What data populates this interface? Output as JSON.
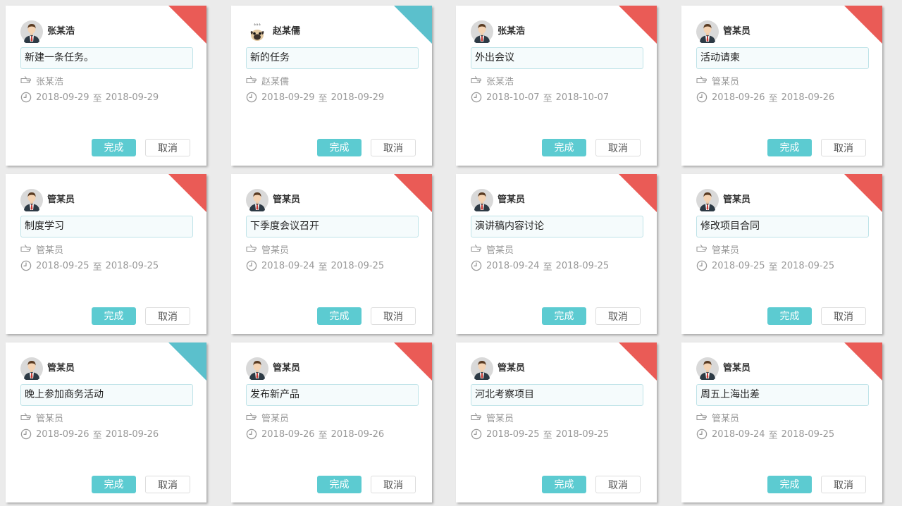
{
  "colors": {
    "done_button": "#5ccbd1",
    "corner_red": "#ea5b56",
    "corner_teal": "#5bc0cc"
  },
  "labels": {
    "done": "完成",
    "cancel": "取消",
    "date_separator": "至"
  },
  "tasks": [
    {
      "owner": "张某浩",
      "avatar": "man-avatar",
      "title": "新建一条任务。",
      "assignee": "张某浩",
      "start": "2018-09-29",
      "end": "2018-09-29",
      "corner": "red"
    },
    {
      "owner": "赵某儒",
      "avatar": "pug-avatar",
      "title": "新的任务",
      "assignee": "赵某儒",
      "start": "2018-09-29",
      "end": "2018-09-29",
      "corner": "teal"
    },
    {
      "owner": "张某浩",
      "avatar": "man-avatar",
      "title": "外出会议",
      "assignee": "张某浩",
      "start": "2018-10-07",
      "end": "2018-10-07",
      "corner": "red"
    },
    {
      "owner": "管某员",
      "avatar": "man-avatar",
      "title": "活动请柬",
      "assignee": "管某员",
      "start": "2018-09-26",
      "end": "2018-09-26",
      "corner": "red"
    },
    {
      "owner": "管某员",
      "avatar": "man-avatar",
      "title": "制度学习",
      "assignee": "管某员",
      "start": "2018-09-25",
      "end": "2018-09-25",
      "corner": "red"
    },
    {
      "owner": "管某员",
      "avatar": "man-avatar",
      "title": "下季度会议召开",
      "assignee": "管某员",
      "start": "2018-09-24",
      "end": "2018-09-25",
      "corner": "red"
    },
    {
      "owner": "管某员",
      "avatar": "man-avatar",
      "title": "演讲稿内容讨论",
      "assignee": "管某员",
      "start": "2018-09-24",
      "end": "2018-09-25",
      "corner": "red"
    },
    {
      "owner": "管某员",
      "avatar": "man-avatar",
      "title": "修改项目合同",
      "assignee": "管某员",
      "start": "2018-09-25",
      "end": "2018-09-25",
      "corner": "red"
    },
    {
      "owner": "管某员",
      "avatar": "man-avatar",
      "title": "晚上参加商务活动",
      "assignee": "管某员",
      "start": "2018-09-26",
      "end": "2018-09-26",
      "corner": "teal"
    },
    {
      "owner": "管某员",
      "avatar": "man-avatar",
      "title": "发布新产品",
      "assignee": "管某员",
      "start": "2018-09-26",
      "end": "2018-09-26",
      "corner": "red"
    },
    {
      "owner": "管某员",
      "avatar": "man-avatar",
      "title": "河北考察项目",
      "assignee": "管某员",
      "start": "2018-09-25",
      "end": "2018-09-25",
      "corner": "red"
    },
    {
      "owner": "管某员",
      "avatar": "man-avatar",
      "title": "周五上海出差",
      "assignee": "管某员",
      "start": "2018-09-24",
      "end": "2018-09-25",
      "corner": "red"
    }
  ]
}
